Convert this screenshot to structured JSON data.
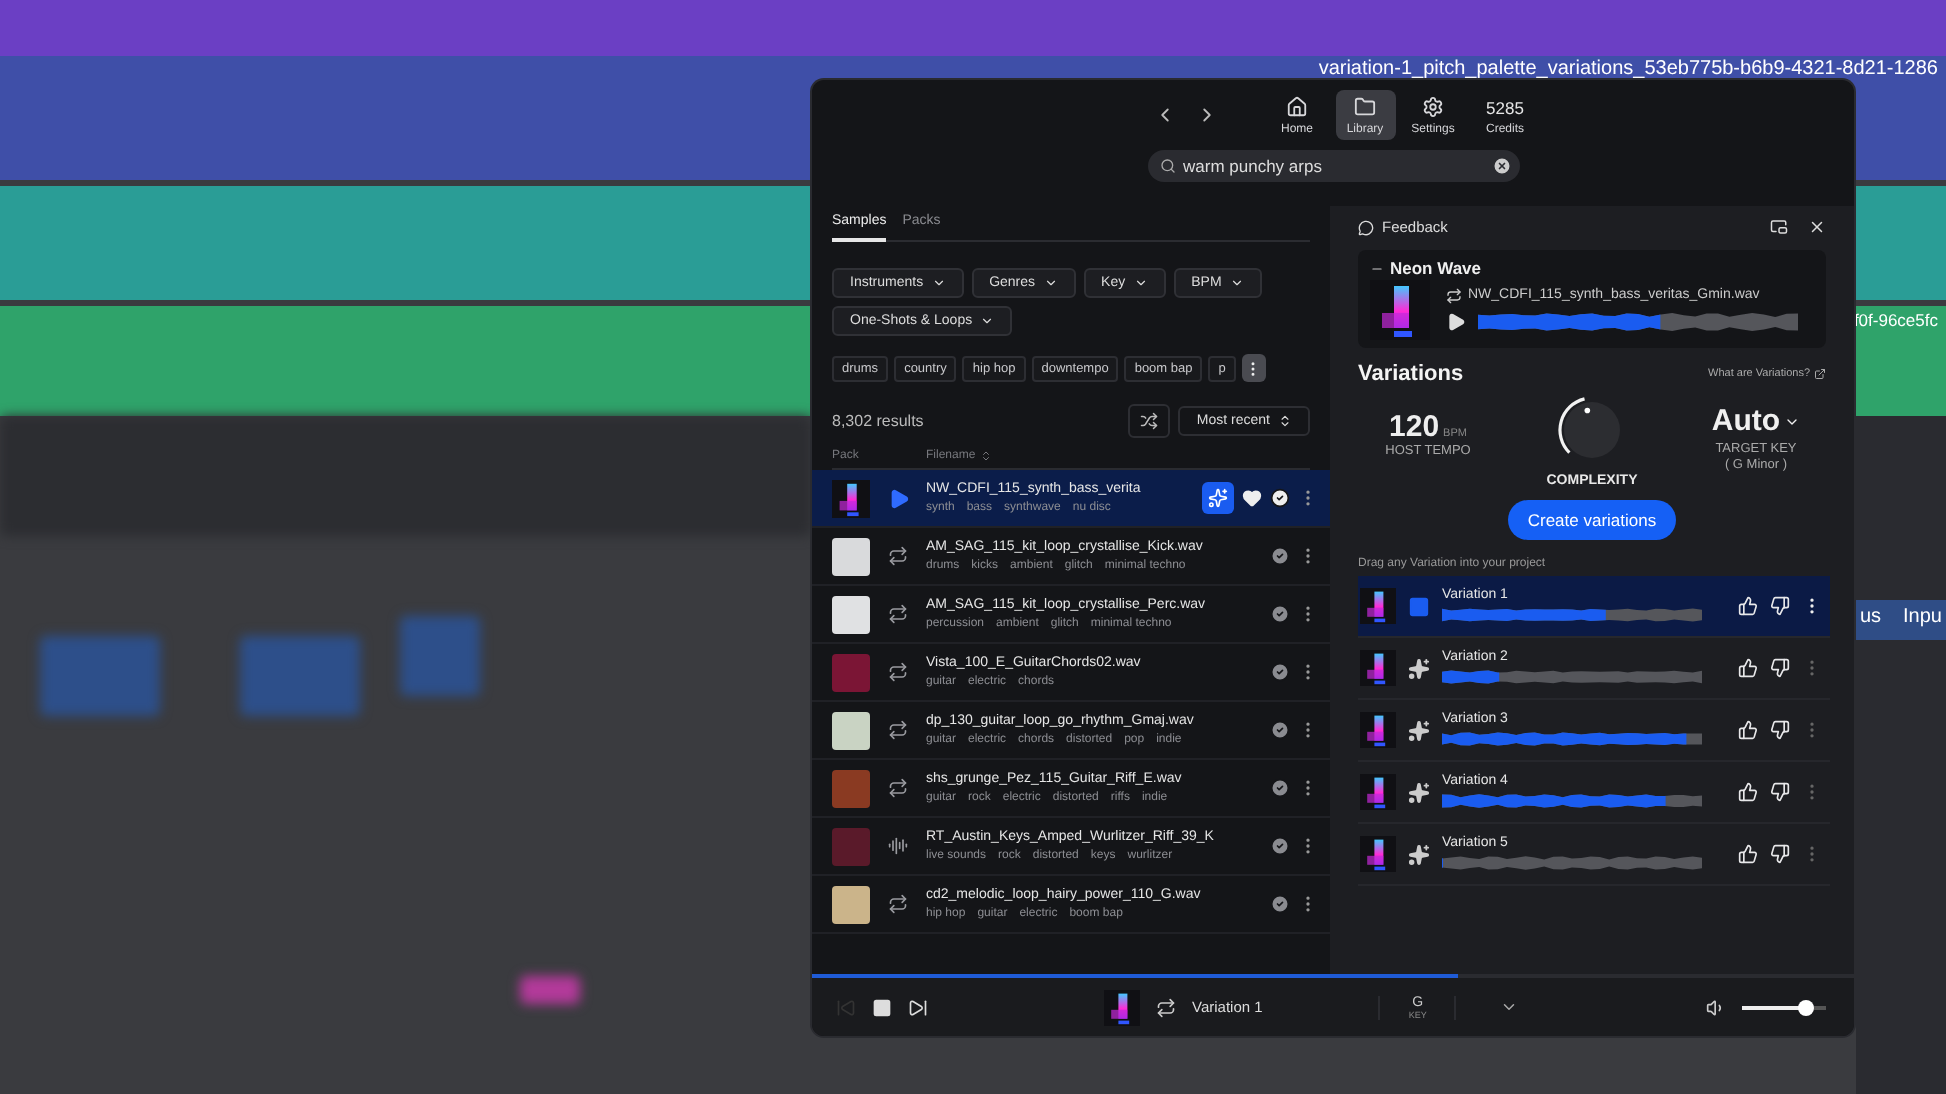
{
  "background": {
    "clip_titles": [
      "variation-1_pitch_palette_variations_53eb775b-b6b9-4321-8d21-1286",
      "f0f-96ce5fc"
    ],
    "track_labels": [
      "us",
      "Inpu"
    ]
  },
  "nav": {
    "items": [
      {
        "label": "Home",
        "kind": "home",
        "selected": false
      },
      {
        "label": "Library",
        "kind": "library",
        "selected": true
      },
      {
        "label": "Settings",
        "kind": "settings",
        "selected": false
      }
    ],
    "credits": {
      "value": "5285",
      "label": "Credits"
    }
  },
  "search": {
    "value": "warm punchy arps"
  },
  "tabs": [
    {
      "label": "Samples",
      "selected": true
    },
    {
      "label": "Packs",
      "selected": false
    }
  ],
  "filters": [
    "Instruments",
    "Genres",
    "Key",
    "BPM",
    "One-Shots & Loops"
  ],
  "tags": [
    "drums",
    "country",
    "hip hop",
    "downtempo",
    "boom bap",
    "p"
  ],
  "results": {
    "count": "8,302 results",
    "sort": "Most recent"
  },
  "columns": [
    "Pack",
    "Filename"
  ],
  "rows": [
    {
      "filename": "NW_CDFI_115_synth_bass_verita",
      "tags": [
        "synth",
        "bass",
        "synthwave",
        "nu disc"
      ],
      "kind": "loop",
      "selected": true
    },
    {
      "filename": "AM_SAG_115_kit_loop_crystallise_Kick.wav",
      "tags": [
        "drums",
        "kicks",
        "ambient",
        "glitch",
        "minimal techno"
      ],
      "kind": "loop",
      "selected": false
    },
    {
      "filename": "AM_SAG_115_kit_loop_crystallise_Perc.wav",
      "tags": [
        "percussion",
        "ambient",
        "glitch",
        "minimal techno"
      ],
      "kind": "loop",
      "selected": false
    },
    {
      "filename": "Vista_100_E_GuitarChords02.wav",
      "tags": [
        "guitar",
        "electric",
        "chords"
      ],
      "kind": "loop",
      "selected": false
    },
    {
      "filename": "dp_130_guitar_loop_go_rhythm_Gmaj.wav",
      "tags": [
        "guitar",
        "electric",
        "chords",
        "distorted",
        "pop",
        "indie"
      ],
      "kind": "loop",
      "selected": false
    },
    {
      "filename": "shs_grunge_Pez_115_Guitar_Riff_E.wav",
      "tags": [
        "guitar",
        "rock",
        "electric",
        "distorted",
        "riffs",
        "indie"
      ],
      "kind": "loop",
      "selected": false
    },
    {
      "filename": "RT_Austin_Keys_Amped_Wurlitzer_Riff_39_K",
      "tags": [
        "live sounds",
        "rock",
        "distorted",
        "keys",
        "wurlitzer"
      ],
      "kind": "oneshot",
      "selected": false
    },
    {
      "filename": "cd2_melodic_loop_hairy_power_110_G.wav",
      "tags": [
        "hip hop",
        "guitar",
        "electric",
        "boom bap"
      ],
      "kind": "loop",
      "selected": false
    }
  ],
  "panel": {
    "feedback": "Feedback",
    "source": {
      "pack": "Neon Wave",
      "filename": "NW_CDFI_115_synth_bass_veritas_Gmin.wav",
      "level": 0.57
    },
    "title": "Variations",
    "help_link": "What are Variations?",
    "tempo": {
      "value": "120",
      "unit": "BPM",
      "label": "HOST TEMPO"
    },
    "complexity": {
      "label": "COMPLEXITY",
      "level": 0.45
    },
    "key": {
      "value": "Auto",
      "label": "TARGET KEY",
      "detail": "( G Minor )"
    },
    "create_button": "Create variations",
    "drag_hint": "Drag any Variation into your project",
    "variations": [
      {
        "name": "Variation 1",
        "selected": true,
        "level": 0.63
      },
      {
        "name": "Variation 2",
        "selected": false,
        "level": 0.22
      },
      {
        "name": "Variation 3",
        "selected": false,
        "level": 0.94
      },
      {
        "name": "Variation 4",
        "selected": false,
        "level": 0.86
      },
      {
        "name": "Variation 5",
        "selected": false,
        "level": 0
      }
    ]
  },
  "player": {
    "level": 0.62,
    "now_playing": "Variation 1",
    "key": {
      "value": "G",
      "label": "KEY"
    },
    "volume": {
      "level": 0.75
    }
  }
}
